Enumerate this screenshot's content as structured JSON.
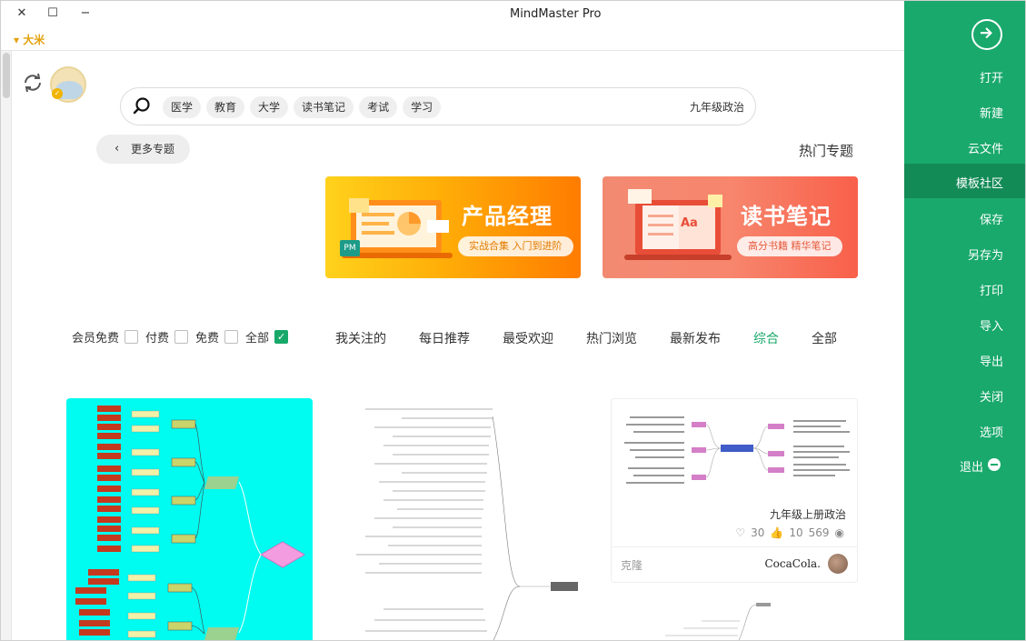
{
  "window": {
    "title": "MindMaster Pro",
    "close_glyph": "✕",
    "maximize_glyph": "☐",
    "minimize_glyph": "−"
  },
  "user": {
    "name": "大米",
    "dropdown": "▾"
  },
  "search": {
    "value": "九年级政治",
    "tags": [
      "学习",
      "考试",
      "读书笔记",
      "大学",
      "教育",
      "医学"
    ],
    "icon": "search-icon"
  },
  "hot_topics": {
    "title": "热门专题",
    "more_label": "更多专题",
    "more_chevron": "‹",
    "banners": [
      {
        "title": "读书笔记",
        "subtitle": "高分书籍 精华笔记",
        "color": "#f8604a",
        "tag": "Aa"
      },
      {
        "title": "产品经理",
        "subtitle": "实战合集 入门到进阶",
        "color": "#ff8a00",
        "tag": "PM"
      }
    ]
  },
  "filters": {
    "checkboxes": [
      {
        "label": "全部",
        "checked": true
      },
      {
        "label": "免费",
        "checked": false
      },
      {
        "label": "付费",
        "checked": false
      },
      {
        "label": "会员免费",
        "checked": false
      }
    ],
    "sort_tabs": [
      "全部",
      "综合",
      "最新发布",
      "热门浏览",
      "最受欢迎",
      "每日推荐",
      "我关注的"
    ],
    "active_tab": "综合"
  },
  "cards": [
    {
      "title": "九年级上册政治",
      "views": "569",
      "likes": "10",
      "favorites": "30",
      "author": "CocaCola.",
      "action": "克隆"
    }
  ],
  "sidebar": {
    "items": [
      "打开",
      "新建",
      "云文件",
      "模板社区",
      "保存",
      "另存为",
      "打印",
      "导入",
      "导出",
      "关闭",
      "选项",
      "退出"
    ],
    "active": "模板社区"
  },
  "colors": {
    "accent": "#19a96c",
    "accent_dark": "#138b57",
    "username": "#e3a10b",
    "cyan_card": "#00fbf0"
  }
}
